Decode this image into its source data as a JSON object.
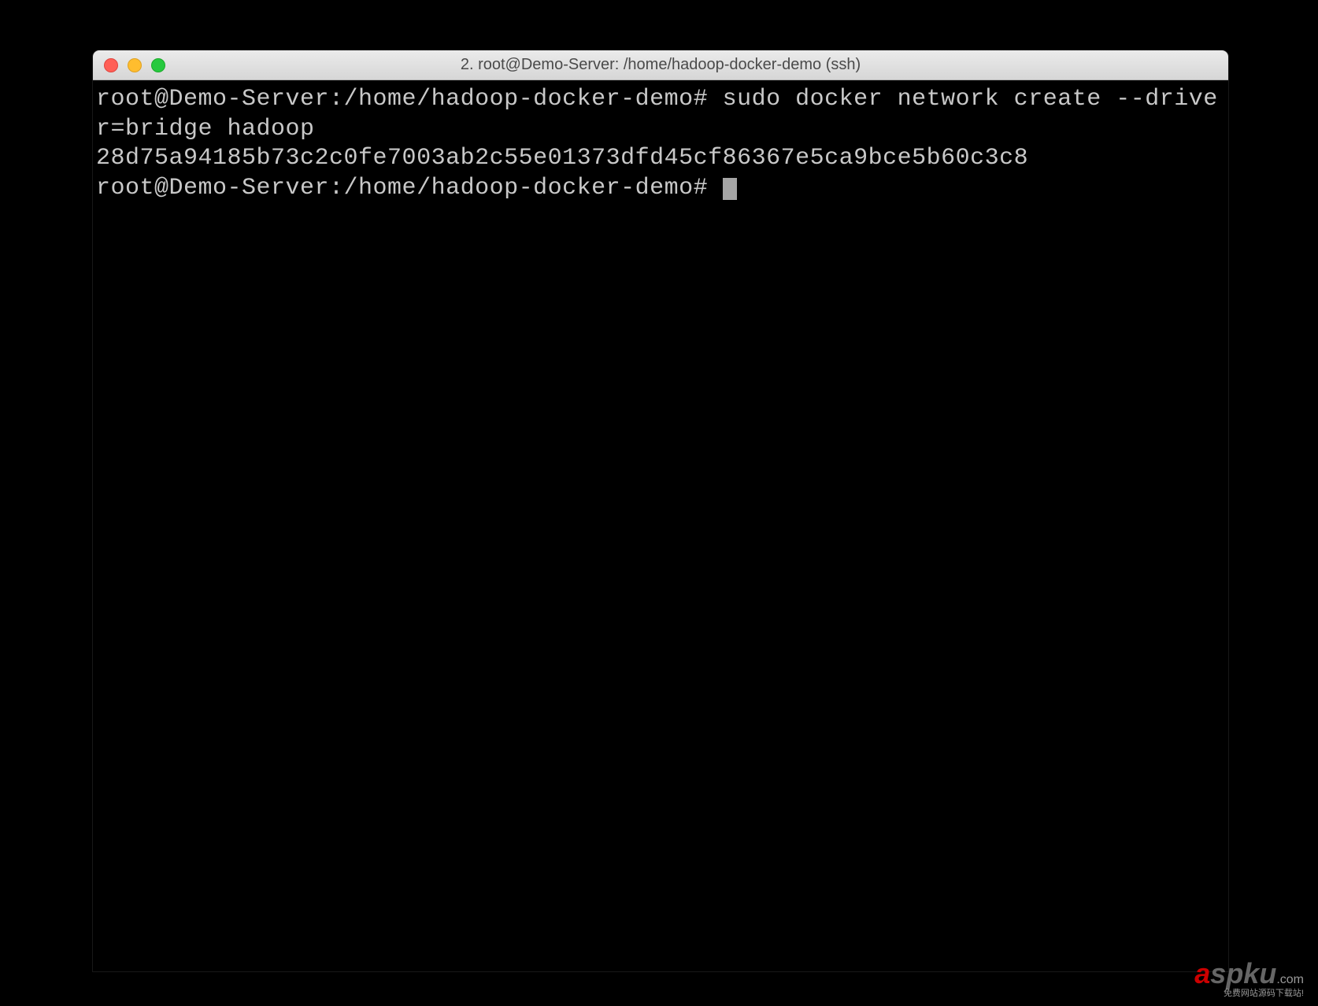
{
  "window": {
    "title": "2. root@Demo-Server: /home/hadoop-docker-demo (ssh)"
  },
  "terminal": {
    "line1": "root@Demo-Server:/home/hadoop-docker-demo# sudo docker network create --driver=bridge hadoop",
    "line2": "28d75a94185b73c2c0fe7003ab2c55e01373dfd45cf86367e5ca9bce5b60c3c8",
    "line3": "root@Demo-Server:/home/hadoop-docker-demo# "
  },
  "watermark": {
    "brand_a": "a",
    "brand_spku": "spku",
    "brand_com": ".com",
    "subtitle": "免费网站源码下载站!"
  }
}
